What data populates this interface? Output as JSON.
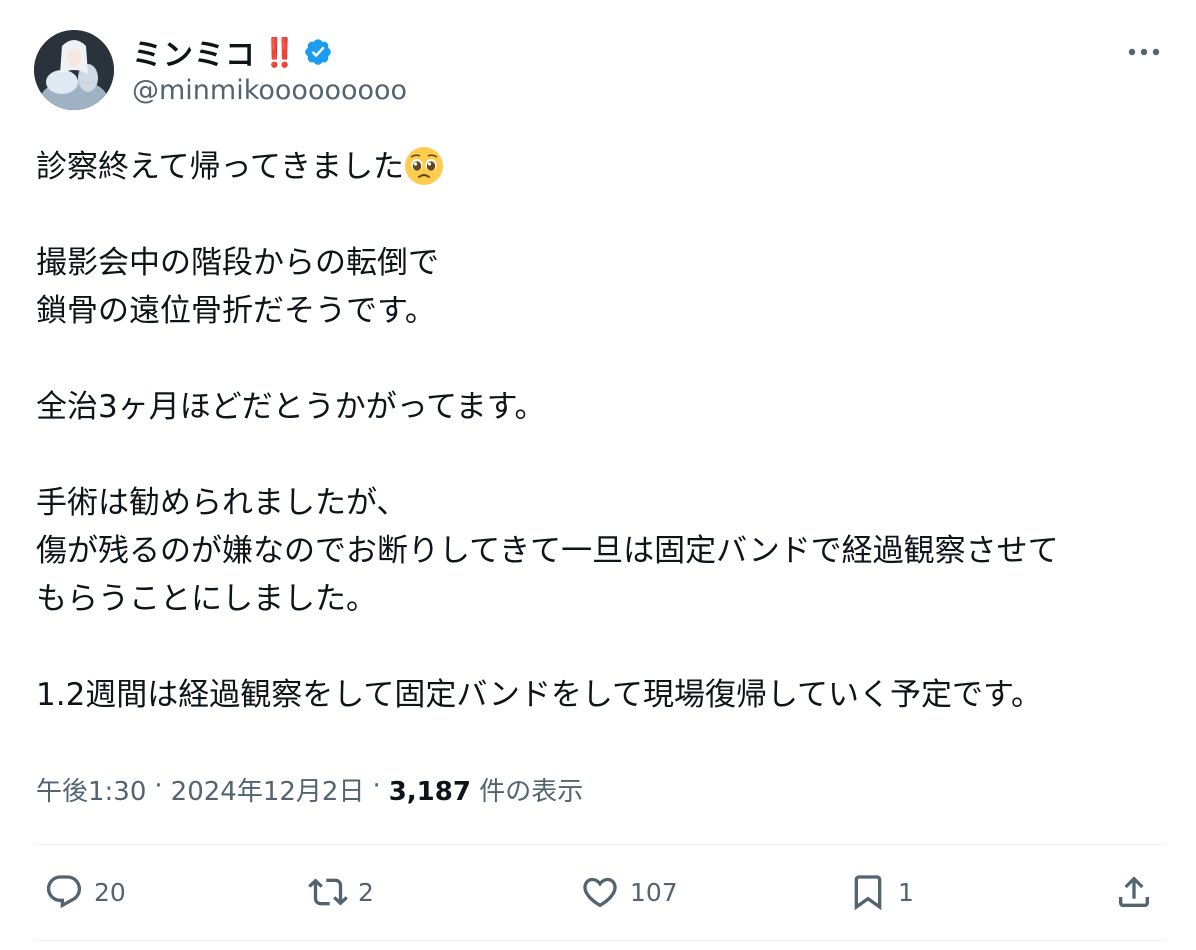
{
  "user": {
    "display_name": "ミンミコ",
    "display_badge": "‼️",
    "handle": "@minmikooooooooo",
    "verified": true,
    "verified_color": "#1d9bf0"
  },
  "tweet": {
    "line1": "診察終えて帰ってきました",
    "line1_emoji": "pleading-face-emoji",
    "para2": "撮影会中の階段からの転倒で\n鎖骨の遠位骨折だそうです。",
    "para3": "全治3ヶ月ほどだとうかがってます。",
    "para4": "手術は勧められましたが、\n傷が残るのが嫌なのでお断りしてきて一旦は固定バンドで経過観察させて\nもらうことにしました。",
    "para5": "1.2週間は経過観察をして固定バンドをして現場復帰していく予定です。"
  },
  "meta": {
    "time": "午後1:30",
    "dot1": "·",
    "date": "2024年12月2日",
    "dot2": "·",
    "views": "3,187",
    "views_label": "件の表示"
  },
  "actions": {
    "reply_icon": "reply-icon",
    "reply_count": "20",
    "retweet_icon": "retweet-icon",
    "retweet_count": "2",
    "like_icon": "heart-icon",
    "like_count": "107",
    "bookmark_icon": "bookmark-icon",
    "bookmark_count": "1",
    "share_icon": "share-icon"
  },
  "colors": {
    "text": "#0f1419",
    "secondary": "#536471",
    "divider": "#eff3f4",
    "badge_red": "#e0112b"
  }
}
